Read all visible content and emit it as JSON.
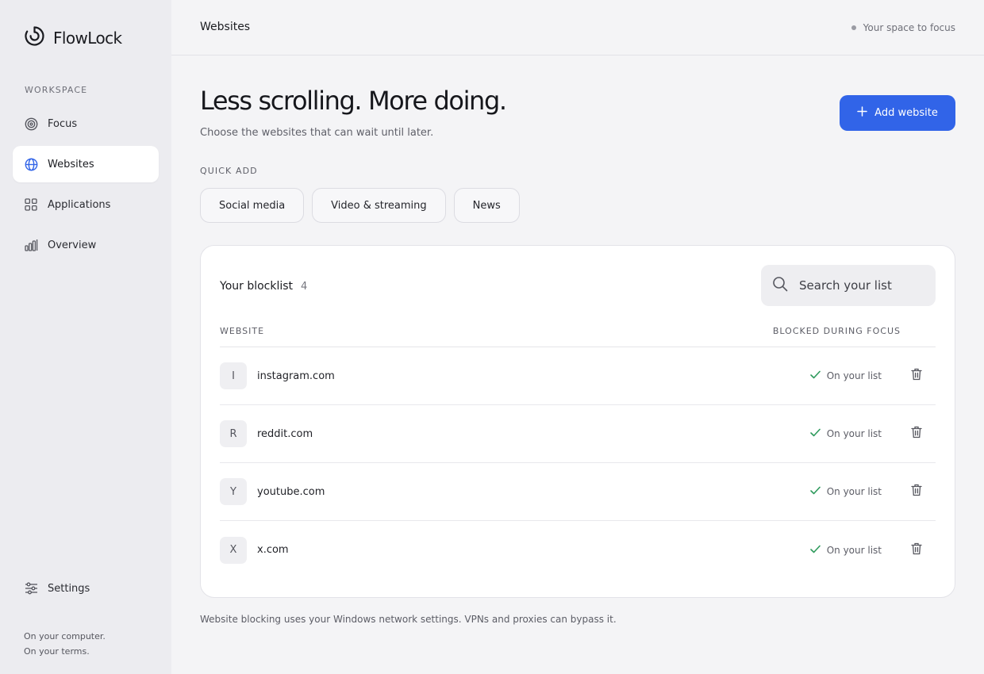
{
  "app": {
    "name": "FlowLock"
  },
  "sidebar": {
    "section_label": "WORKSPACE",
    "items": [
      {
        "label": "Focus",
        "icon": "target-icon",
        "active": false
      },
      {
        "label": "Websites",
        "icon": "globe-icon",
        "active": true
      },
      {
        "label": "Applications",
        "icon": "grid-icon",
        "active": false
      },
      {
        "label": "Overview",
        "icon": "bar-chart-icon",
        "active": false
      }
    ],
    "settings_label": "Settings",
    "footer_line1": "On your computer.",
    "footer_line2": "On your terms."
  },
  "topbar": {
    "breadcrumb": "Websites",
    "tagline": "Your space to focus"
  },
  "header": {
    "title": "Less scrolling. More doing.",
    "subtitle": "Choose the websites that can wait until later.",
    "add_button": "Add website"
  },
  "quick_add": {
    "label": "QUICK ADD",
    "chips": [
      "Social media",
      "Video & streaming",
      "News"
    ]
  },
  "blocklist": {
    "title": "Your blocklist",
    "count": "4",
    "search_placeholder": "Search your list",
    "col_website": "WEBSITE",
    "col_status": "BLOCKED DURING FOCUS",
    "rows": [
      {
        "initial": "I",
        "site": "instagram.com",
        "status": "On your list"
      },
      {
        "initial": "R",
        "site": "reddit.com",
        "status": "On your list"
      },
      {
        "initial": "Y",
        "site": "youtube.com",
        "status": "On your list"
      },
      {
        "initial": "X",
        "site": "x.com",
        "status": "On your list"
      }
    ]
  },
  "disclaimer": "Website blocking uses your Windows network settings. VPNs and proxies can bypass it.",
  "colors": {
    "accent": "#3164e8",
    "check": "#2e9a5c",
    "sidebar_bg": "#ececf0",
    "page_bg": "#f4f4f6"
  }
}
